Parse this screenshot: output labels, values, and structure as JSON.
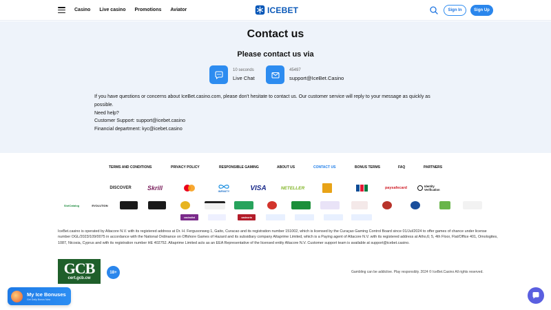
{
  "header": {
    "nav": [
      "Casino",
      "Live casino",
      "Promotions",
      "Aviator"
    ],
    "logo_text": "ICEBET",
    "signin_label": "Sign In",
    "signup_label": "Sign Up"
  },
  "contact": {
    "title": "Contact us",
    "subtitle": "Please contact us via",
    "chat": {
      "sub": "10 seconds",
      "label": "Live Chat"
    },
    "email": {
      "sub": "45497",
      "label": "support@IceBet.Casino"
    },
    "paragraph": [
      "If you have questions or concerns about IceBet.casino.com, please don't hesitate to contact us. Our customer service will reply to your message as quickly as",
      "possible.",
      "Need help?",
      "Customer Support: support@icebet.casino",
      "Financial department: kyc@icebet.casino"
    ]
  },
  "footer": {
    "links": [
      "TERMS AND CONDITIONS",
      "PRIVACY POLICY",
      "RESPONSIBLE GAMING",
      "ABOUT US",
      "CONTACT US",
      "BONUS TERMS",
      "FAQ",
      "PARTNERS"
    ],
    "active_link": "CONTACT US",
    "payments": [
      "DISCOVER",
      "Skrill",
      "mastercard",
      "INFINITY",
      "VISA",
      "NETELLER",
      "",
      "JCB",
      "paysafecard",
      "Identity Verification"
    ],
    "providers_row1": [
      "SlotCatalog",
      "EVOLUTION",
      "",
      "",
      "",
      "",
      "",
      "",
      "",
      "",
      "",
      "",
      "",
      ""
    ],
    "providers_row2": [
      "",
      "",
      "casinolist",
      "",
      "",
      "",
      "",
      "casinoria"
    ],
    "legal": "IceBet.casino is operated by Altacore N.V. with its registered address at Dr. H. Fergusonweg 1, Gaito, Curacao and its registration number 151002, which is licensed by the Curaçao Gaming Control Board since 01/Jul/2024 to offer games of chance under license number OGL/2023/109/0075 in accordance with the National Ordinance on Offshore Games of Hazard and its subsidiary company Altaprime Limited, which is a Paying agent of Altacore N.V. with its registered address at Atho,6; 5, 4th Floor, Flat/Office 401, Omologites, 1087, Nicosia, Cyprus and with its registration number HE 402752. Altaprime Limited acts as an EEA Representative of the licensed entity Altacore N.V. Customer support team is available at support@icebet.casino.",
    "gcb_big": "GCB",
    "gcb_small": "cert.gcb.cw",
    "age": "18+",
    "gambling_note": "Gambling can be addictive. Play responsibly. 2024 © IceBet.Casino All rights reserved."
  },
  "bonus_widget": {
    "title": "My Ice Bonuses",
    "sub": "Get Daily Bonus Now"
  },
  "colors": {
    "accent": "#2a86ec",
    "contact_bg": "#eef3fa",
    "gcb": "#1f5f2a",
    "chat_fab": "#5a5fe0"
  }
}
